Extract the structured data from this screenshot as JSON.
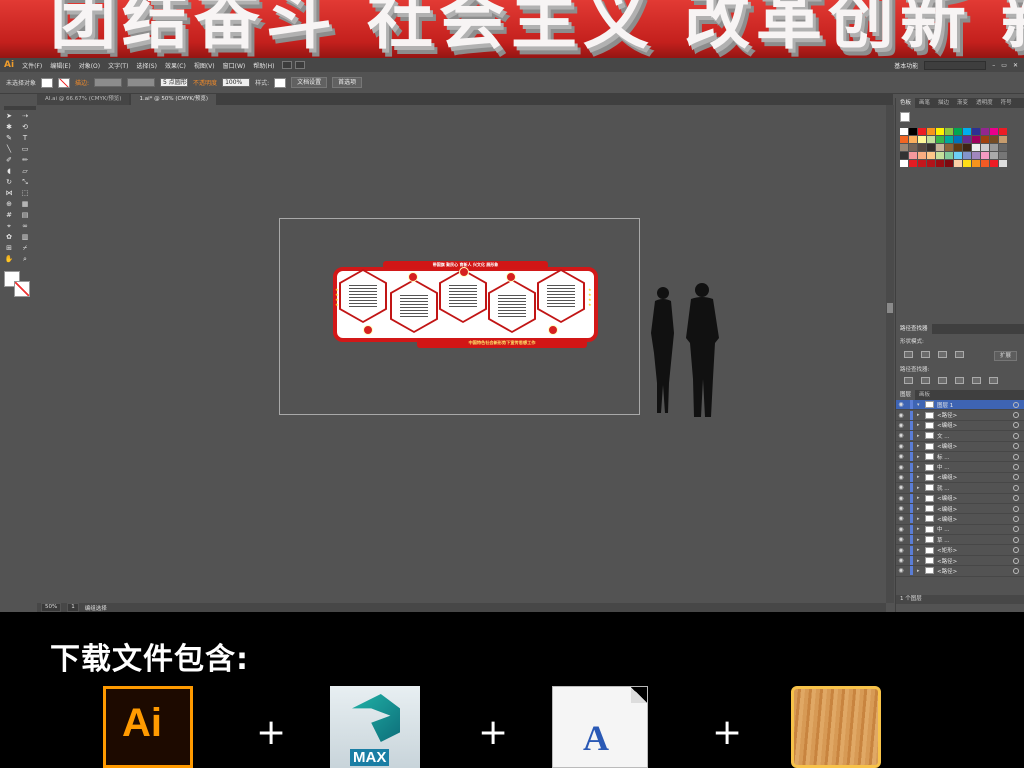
{
  "banner": {
    "ghost_text": "团结奋斗 社会主义 改革创新 新形势下宣传思想工作"
  },
  "app": {
    "logo": "Ai",
    "menus": [
      "文件(F)",
      "编辑(E)",
      "对象(O)",
      "文字(T)",
      "选择(S)",
      "效果(C)",
      "视图(V)",
      "窗口(W)",
      "帮助(H)"
    ],
    "workspace": "基本功能"
  },
  "control_bar": {
    "selection": "未选择对象",
    "stroke_label": "描边:",
    "brush": "5 点圆形",
    "opacity_label": "不透明度",
    "opacity_value": "100%",
    "style_label": "样式:",
    "doc_setup": "文档设置",
    "preferences": "首选项"
  },
  "tabs": [
    {
      "label": "AI.ai @ 66.67% (CMYK/预览)",
      "active": false
    },
    {
      "label": "1.ai* @ 50% (CMYK/预览)",
      "active": true
    }
  ],
  "artwork": {
    "top_slogan": "带国旗  聚民心  育新人  兴文化  展形象",
    "bottom_title": "中国特色社会新形势下宣传思想工作"
  },
  "status": {
    "zoom": "50%",
    "page": "1",
    "tool": "编组选择"
  },
  "panels": {
    "swatch_tabs": [
      "色板",
      "画笔",
      "描边",
      "渐变",
      "透明度",
      "符号"
    ],
    "pathfinder_tab": "路径查找器",
    "shape_modes_label": "形状模式:",
    "pathfinders_label": "路径查找器:",
    "expand_button": "扩展",
    "layer_tabs": [
      "图层",
      "画板"
    ],
    "layers": [
      "图层 1",
      "<路径>",
      "<编组>",
      "文 ...",
      "<编组>",
      "标 ...",
      "中 ...",
      "<编组>",
      "就 ...",
      "<编组>",
      "<编组>",
      "<编组>",
      "中 ...",
      "草 ...",
      "<矩形>",
      "<路径>",
      "<路径>"
    ],
    "layer_count": "1 个图层"
  },
  "colors": {
    "swatches": [
      "#ffffff",
      "#000000",
      "#ed1c24",
      "#f7941d",
      "#fff200",
      "#8dc63f",
      "#00a651",
      "#00aeef",
      "#2e3192",
      "#92278f",
      "#ec008c",
      "#ed1c24",
      "#f26522",
      "#fbaf5d",
      "#fff799",
      "#c4df9b",
      "#39b54a",
      "#00a99d",
      "#0072bc",
      "#662d91",
      "#9e005d",
      "#a0410d",
      "#754c24",
      "#c69c6d",
      "#998675",
      "#736357",
      "#534741",
      "#362f2d",
      "#c7b299",
      "#8c6239",
      "#603913",
      "#3c2415",
      "#eeeeee",
      "#cccccc",
      "#999999",
      "#666666",
      "#333333",
      "#f5989d",
      "#f9ad81",
      "#fdc689",
      "#c4df9b",
      "#82ca9c",
      "#6dcff6",
      "#8393ca",
      "#a187be",
      "#f49ac1",
      "#aaaaaa",
      "#777777",
      "#ffffff",
      "#e31c23",
      "#c4161c",
      "#b11319",
      "#980d12",
      "#7d0a0f",
      "#fbd0a6",
      "#ffde17",
      "#f7941d",
      "#f15a24",
      "#ed1c24",
      "#dddddd"
    ]
  },
  "download": {
    "title": "下载文件包含:",
    "ai_label": "Ai",
    "max_label": "MAX",
    "font_label": "A",
    "plus": "+"
  }
}
